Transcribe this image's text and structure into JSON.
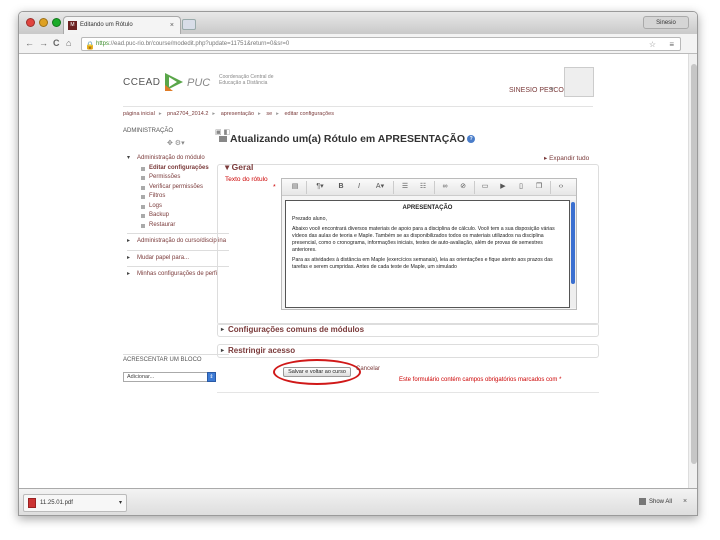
{
  "browser": {
    "tab_title": "Editando um Rótulo",
    "tab_close": "×",
    "user_button": "Sinesio",
    "url_scheme": "https",
    "url_rest": "://ead.puc-rio.br/course/modedit.php?update=11751&return=0&sr=0",
    "nav": {
      "back": "←",
      "forward": "→",
      "reload": "C",
      "home": "⌂"
    }
  },
  "site": {
    "logo_text": "CCEAD",
    "logo_brand": "PUC",
    "logo_sub": "Coordenação Central de Educação a Distância",
    "user_name": "SINESIO PESCO"
  },
  "breadcrumb": [
    "página inicial",
    "pna2704_2014.2",
    "apresentação",
    "se",
    "editar configurações"
  ],
  "admin": {
    "title": "ADMINISTRAÇÃO",
    "module_admin": "Administração do módulo",
    "module_items": [
      "Editar configurações",
      "Permissões",
      "Verificar permissões",
      "Filtros",
      "Logs",
      "Backup",
      "Restaurar"
    ],
    "course_admin": "Administração do curso/disciplina",
    "switch_role": "Mudar papel para...",
    "my_profile": "Minhas configurações de perfil"
  },
  "add_block": {
    "title": "ACRESCENTAR UM BLOCO",
    "select_value": "Adicionar..."
  },
  "page": {
    "title": "Atualizando um(a) Rótulo em APRESENTAÇÃO",
    "expand_all": "Expandir tudo",
    "section_general": "Geral",
    "field_label": "Texto do rótulo",
    "required_mark": "*",
    "section_common": "Configurações comuns de módulos",
    "section_restrict": "Restringir acesso",
    "save_button": "Salvar e voltar ao curso",
    "cancel_link": "Cancelar",
    "required_note": "Este formulário contém campos obrigatórios marcados com"
  },
  "editor": {
    "heading": "APRESENTAÇÃO",
    "greeting": "Prezado aluno,",
    "para1": "Abaixo você encontrará diversos materiais de apoio para a disciplina de cálculo. Você tem a sua disposição várias vídeos das aulas de teoria e Maple. Também se as disponibilizados todos os materiais utilizados na disciplina presencial, como o cronograma, informações iniciais, testes de auto-avaliação, além de provas de semestres anteriores.",
    "para2": "Para as atividades à distância em Maple (exercícios semanais), leia as orientações e fique atento aos prazos das tarefas e serem cumpridas. Antes de cada teste de Maple, um simulado"
  },
  "downloads": {
    "file": "11.25.01.pdf",
    "show_all": "Show All",
    "close": "×"
  },
  "colors": {
    "link": "#7a3a3a",
    "required": "#cc0000",
    "highlight_oval": "#d01818",
    "accent": "#3a6fd0"
  }
}
